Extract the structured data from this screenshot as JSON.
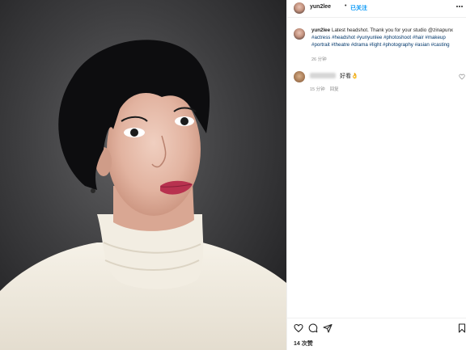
{
  "header": {
    "username": "yun2lee",
    "separator": "•",
    "follow_label": "已关注",
    "more_icon": "more-icon"
  },
  "caption": {
    "username": "yun2lee",
    "text": "Latest headshot. Thank you for your studio @zinapunx",
    "hashtags": "#actress #headshot #yunyunlee #photoshoot #hair #makeup #portrait #theatre #drama #light #photography #asian #casting",
    "time": "26 分钟"
  },
  "comment": {
    "text": "好看👌",
    "time": "15 分钟",
    "reply_label": "回复",
    "like_icon": "heart-outline-icon"
  },
  "actions": {
    "like_icon": "heart-icon",
    "comment_icon": "comment-icon",
    "share_icon": "share-icon",
    "save_icon": "bookmark-icon",
    "likes_text": "14 次赞"
  },
  "colors": {
    "link": "#00376b",
    "follow": "#0095f6",
    "muted": "#8e8e8e"
  }
}
